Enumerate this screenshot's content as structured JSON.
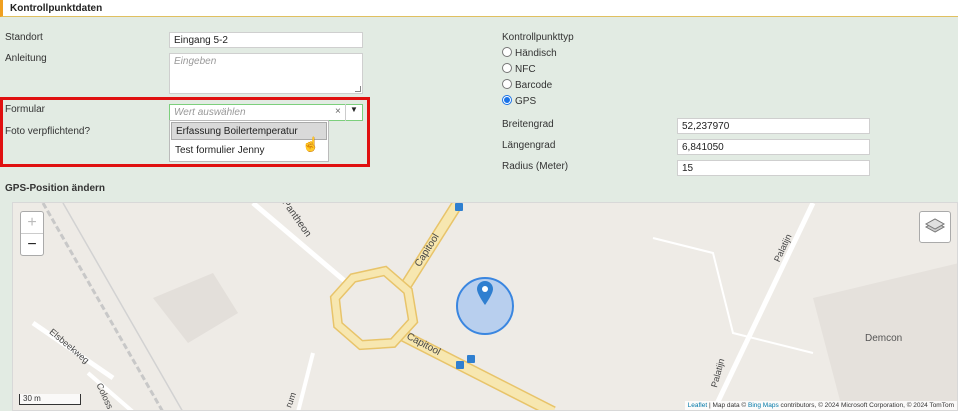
{
  "header": {
    "title": "Kontrollpunktdaten"
  },
  "form": {
    "standort": {
      "label": "Standort",
      "value": "Eingang 5-2"
    },
    "anleitung": {
      "label": "Anleitung",
      "placeholder": "Eingeben"
    },
    "formular": {
      "label": "Formular",
      "placeholder": "Wert auswählen",
      "clear_symbol": "×",
      "options": [
        "Erfassung Boilertemperatur",
        "Test formulier Jenny"
      ]
    },
    "foto": {
      "label": "Foto verpflichtend?"
    }
  },
  "typ": {
    "label": "Kontrollpunkttyp",
    "options": [
      {
        "label": "Händisch",
        "selected": false
      },
      {
        "label": "NFC",
        "selected": false
      },
      {
        "label": "Barcode",
        "selected": false
      },
      {
        "label": "GPS",
        "selected": true
      }
    ]
  },
  "gps": {
    "breitengrad": {
      "label": "Breitengrad",
      "value": "52,237970"
    },
    "laengengrad": {
      "label": "Längengrad",
      "value": "6,841050"
    },
    "radius": {
      "label": "Radius (Meter)",
      "value": "15"
    }
  },
  "map": {
    "section_title": "GPS-Position ändern",
    "zoom_in": "+",
    "zoom_out": "−",
    "scale": "30 m",
    "streets": [
      "Pantheon",
      "Capitool",
      "Capitool",
      "Elsbeekweg",
      "Coloss",
      "rum",
      "Palatijn",
      "Palatijn",
      "Demcon"
    ],
    "attribution": {
      "leaflet": "Leaflet",
      "text1": "| Map data ©",
      "bing": "Bing Maps",
      "text2": "contributors, © 2024 Microsoft Corporation, © 2024 TomTom"
    },
    "colors": {
      "road": "#f7e7b0",
      "road_edge": "#e8c46a",
      "marker": "#2f7fd0",
      "circle_fill": "#aac8f0",
      "circle_edge": "#3a86e0"
    }
  },
  "icons": {
    "dropdown_arrow": "caret-down-icon",
    "layers": "layers-icon",
    "cursor": "hand-pointer-icon",
    "marker": "map-pin-icon",
    "bus": "bus-stop-icon"
  }
}
